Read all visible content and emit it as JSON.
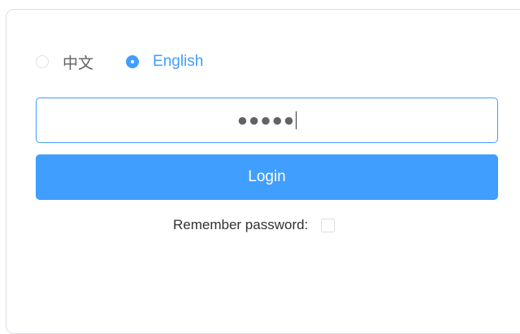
{
  "language": {
    "options": [
      {
        "label": "中文",
        "checked": false
      },
      {
        "label": "English",
        "checked": true
      }
    ]
  },
  "password": {
    "value": "●●●●●"
  },
  "login": {
    "label": "Login"
  },
  "remember": {
    "label": "Remember password:",
    "checked": false
  },
  "colors": {
    "primary": "#409eff",
    "border": "#dcdfe6",
    "text": "#303133",
    "muted": "#606266"
  }
}
